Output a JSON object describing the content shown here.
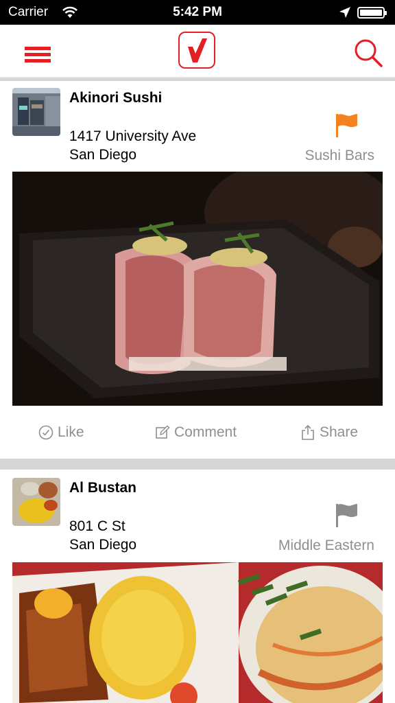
{
  "status_bar": {
    "carrier": "Carrier",
    "time": "5:42 PM"
  },
  "nav": {
    "menu_icon": "hamburger-menu-icon",
    "logo_icon": "checkmark-logo-icon",
    "search_icon": "search-icon"
  },
  "colors": {
    "brand_red": "#e31e24",
    "flag_orange": "#f58220",
    "flag_grey": "#8c8c8c",
    "muted": "#8e8e93"
  },
  "feed": [
    {
      "name": "Akinori Sushi",
      "address_line1": "1417 University Ave",
      "address_line2": "San Diego",
      "category": "Sushi Bars",
      "flag_color": "orange",
      "actions": {
        "like": "Like",
        "comment": "Comment",
        "share": "Share"
      }
    },
    {
      "name": "Al Bustan",
      "address_line1": "801 C St",
      "address_line2": "San Diego",
      "category": "Middle Eastern",
      "flag_color": "grey"
    }
  ]
}
